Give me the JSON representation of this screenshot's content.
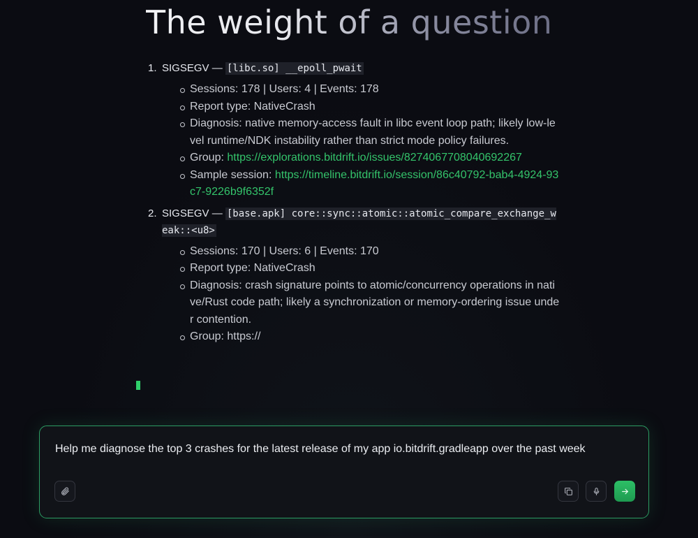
{
  "page": {
    "title": "The weight of a question"
  },
  "crashes": [
    {
      "number": "1.",
      "signal": "SIGSEGV —",
      "frame": "[libc.so] __epoll_pwait",
      "details": {
        "stats": "Sessions: 178 | Users: 4 | Events: 178",
        "report_type": "Report type: NativeCrash",
        "diagnosis": "Diagnosis: native memory-access fault in libc event loop path; likely low-level runtime/NDK instability rather than strict mode policy failures.",
        "group_label": "Group: ",
        "group_url": "https://explorations.bitdrift.io/issues/827406770804069226​7",
        "sample_label": "Sample session: ",
        "sample_url": "https://timeline.bitdrift.io/session/86c40792-bab4-4924-93c7-9226b9f6352f"
      }
    },
    {
      "number": "2.",
      "signal": "SIGSEGV —",
      "frame": "[base.apk] core::sync::atomic::atomic_compare_exchange_weak::<u8>",
      "details": {
        "stats": "Sessions: 170 | Users: 6 | Events: 170",
        "report_type": "Report type: NativeCrash",
        "diagnosis": "Diagnosis: crash signature points to atomic/concurrency operations in native/Rust code path; likely a synchronization or memory-ordering issue under contention.",
        "group_partial": "Group: https://"
      }
    }
  ],
  "composer": {
    "prompt": "Help me diagnose the top 3 crashes for the latest release of my app io.bitdrift.gradleapp over the past week",
    "attach_icon": "paperclip-icon",
    "copy_icon": "copy-icon",
    "mic_icon": "microphone-icon",
    "send_icon": "arrow-right-icon"
  },
  "colors": {
    "background": "#0b0c12",
    "link": "#34c46b",
    "accent": "#2c9c63",
    "cursor": "#2fcf6a"
  }
}
